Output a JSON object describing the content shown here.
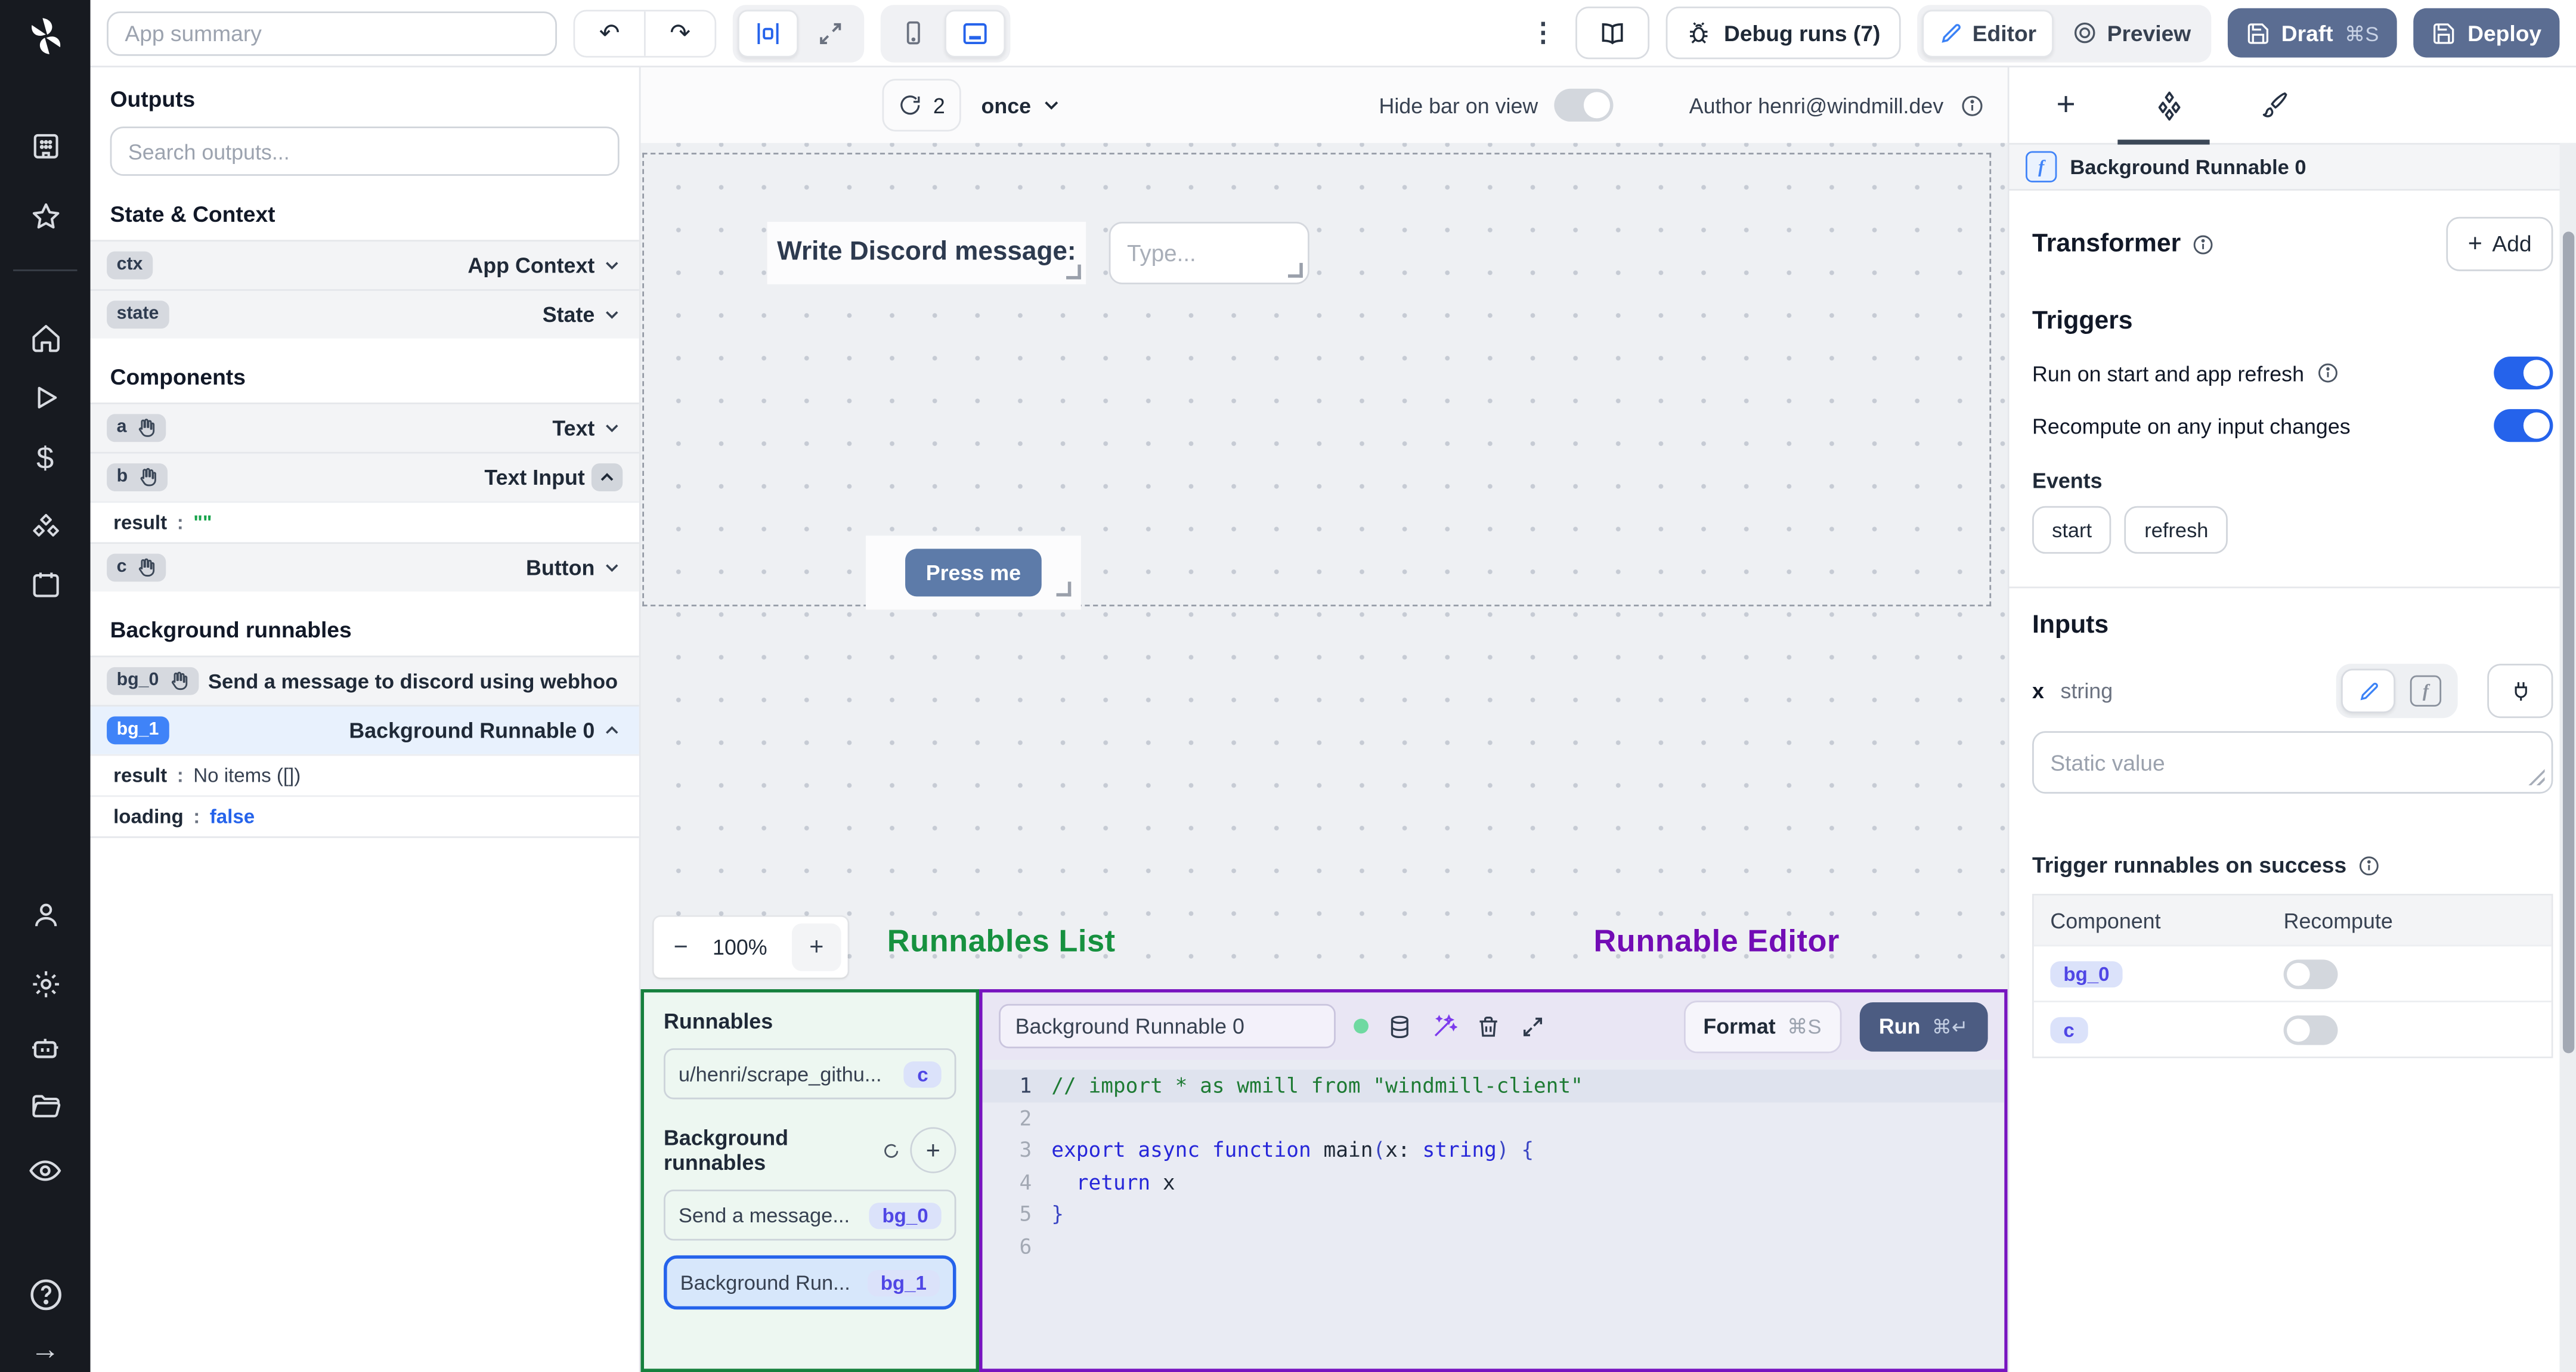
{
  "topbar": {
    "app_summary_placeholder": "App summary",
    "undo_glyph": "↶",
    "redo_glyph": "↷",
    "kebab_glyph": "⋮",
    "debug_runs_label": "Debug runs (7)",
    "editor_label": "Editor",
    "preview_label": "Preview",
    "draft_label": "Draft",
    "draft_shortcut": "⌘S",
    "deploy_label": "Deploy"
  },
  "rail": {
    "dollar_glyph": "$",
    "help_glyph": "?",
    "collapse_glyph": "→"
  },
  "outputs_panel": {
    "title": "Outputs",
    "search_placeholder": "Search outputs...",
    "state_context": {
      "title": "State & Context",
      "rows": [
        {
          "id": "ctx",
          "label": "App Context"
        },
        {
          "id": "state",
          "label": "State"
        }
      ]
    },
    "components": {
      "title": "Components",
      "row_a": {
        "id": "a",
        "label": "Text"
      },
      "row_b": {
        "id": "b",
        "label": "Text Input",
        "result_key": "result",
        "result_colon": ":",
        "result_value": "\"\""
      },
      "row_c": {
        "id": "c",
        "label": "Button"
      }
    },
    "background_runnables": {
      "title": "Background runnables",
      "bg0": {
        "id": "bg_0",
        "label": "Send a message to discord using webhoo"
      },
      "bg1": {
        "id": "bg_1",
        "label": "Background Runnable 0",
        "result_key": "result",
        "result_colon": ":",
        "result_value": "No items ([])",
        "loading_key": "loading",
        "loading_colon": ":",
        "loading_value": "false"
      }
    }
  },
  "canvas": {
    "refresh_count": "2",
    "refresh_mode": "once",
    "hide_bar_label": "Hide bar on view",
    "hide_bar_enabled": false,
    "author_label": "Author henri@windmill.dev",
    "text_component": "Write Discord message:",
    "input_placeholder": "Type...",
    "button_label": "Press me",
    "zoom_out": "−",
    "zoom_level": "100%",
    "zoom_in": "+"
  },
  "annotations": {
    "runnables_list": "Runnables List",
    "runnables_list_color": "#16913f",
    "runnable_editor": "Runnable Editor",
    "runnable_editor_color": "#720cb5"
  },
  "runnables_panel": {
    "title": "Runnables",
    "item_path": "u/henri/scrape_githu...",
    "item_path_badge": "c",
    "bg_section_title": "Background runnables",
    "add_plus": "+",
    "bg0_label": "Send a message...",
    "bg0_badge": "bg_0",
    "bg1_label": "Background Run...",
    "bg1_badge": "bg_1"
  },
  "editor": {
    "name_value": "Background Runnable 0",
    "format_label": "Format",
    "format_shortcut": "⌘S",
    "run_label": "Run",
    "run_shortcut": "⌘↵",
    "code": {
      "language_comment_color": "#1e7b34",
      "lines": [
        {
          "n": "1",
          "hl": true,
          "tokens": [
            [
              "c",
              "// import * as wmill from \"windmill-client\""
            ]
          ]
        },
        {
          "n": "2",
          "tokens": []
        },
        {
          "n": "3",
          "tokens": [
            [
              "k",
              "export"
            ],
            [
              "p",
              " "
            ],
            [
              "k",
              "async"
            ],
            [
              "p",
              " "
            ],
            [
              "k",
              "function"
            ],
            [
              "p",
              " "
            ],
            [
              "v",
              "main"
            ],
            [
              "b",
              "("
            ],
            [
              "v",
              "x"
            ],
            [
              "p",
              ": "
            ],
            [
              "k",
              "string"
            ],
            [
              "b",
              ")"
            ],
            [
              "p",
              " "
            ],
            [
              "b",
              "{"
            ]
          ]
        },
        {
          "n": "4",
          "tokens": [
            [
              "p",
              "  "
            ],
            [
              "k",
              "return"
            ],
            [
              "p",
              " x"
            ]
          ]
        },
        {
          "n": "5",
          "tokens": [
            [
              "b",
              "}"
            ]
          ]
        },
        {
          "n": "6",
          "tokens": []
        }
      ]
    }
  },
  "right_panel": {
    "header": "Background Runnable 0",
    "transformer_title": "Transformer",
    "add_plus": "+",
    "add_label": "Add",
    "triggers_title": "Triggers",
    "run_on_start_label": "Run on start and app refresh",
    "run_on_start_enabled": true,
    "recompute_label": "Recompute on any input changes",
    "recompute_enabled": true,
    "events_title": "Events",
    "event_start": "start",
    "event_refresh": "refresh",
    "inputs_title": "Inputs",
    "input_name": "x",
    "input_type": "string",
    "static_value_placeholder": "Static value",
    "trigger_success_title": "Trigger runnables on success",
    "table": {
      "col_component": "Component",
      "col_recompute": "Recompute",
      "rows": [
        {
          "component": "bg_0",
          "recompute": false
        },
        {
          "component": "c",
          "recompute": false
        }
      ]
    }
  },
  "colors": {
    "accent_blue": "#2563eb",
    "selected_badge_blue": "#3f83f8",
    "runnables_border_green": "#15803d",
    "editor_border_purple": "#7714bf",
    "run_button": "#4c5c82",
    "draft_deploy_button": "#5b6d92",
    "press_me_button": "#5d7ba9"
  }
}
